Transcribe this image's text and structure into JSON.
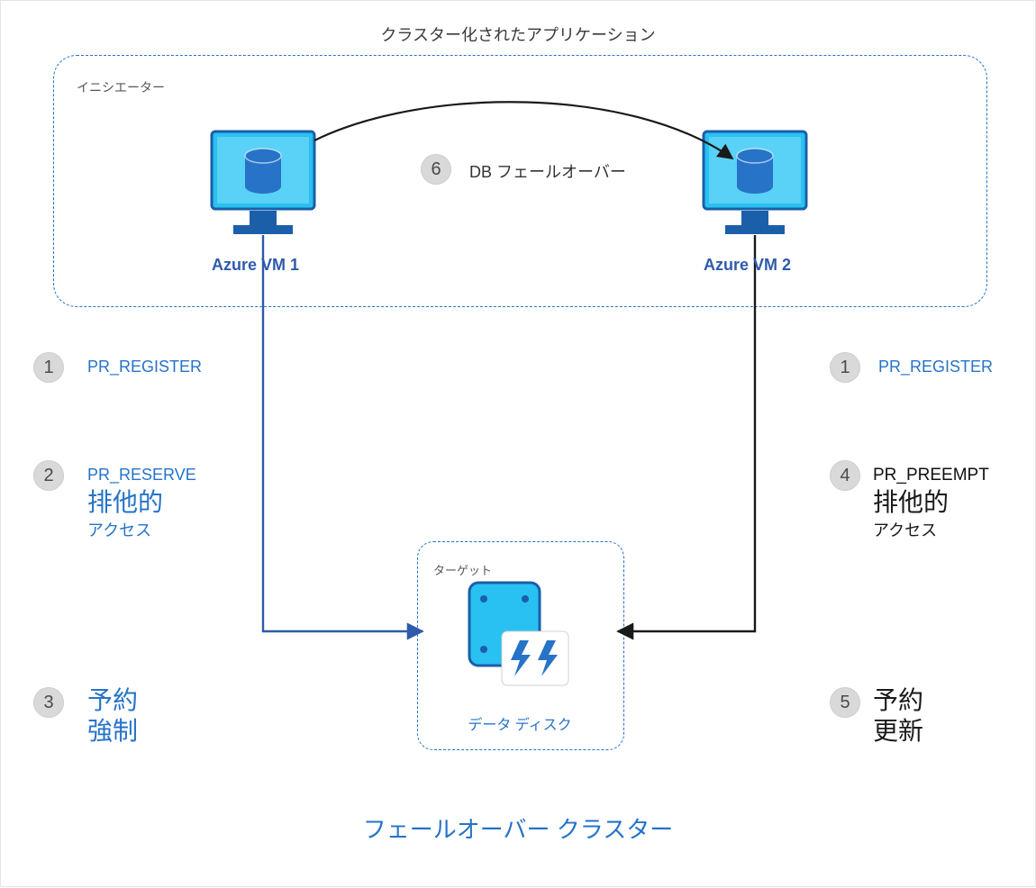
{
  "title": "クラスター化されたアプリケーション",
  "footer_title": "フェールオーバー クラスター",
  "initiator_label": "イニシエーター",
  "target_label": "ターゲット",
  "disk_label": "データ ディスク",
  "vm1_label": "Azure VM 1",
  "vm2_label": "Azure VM 2",
  "step6": {
    "num": "6",
    "label": "DB フェールオーバー"
  },
  "left": {
    "s1": {
      "num": "1",
      "code": "PR_REGISTER"
    },
    "s2": {
      "num": "2",
      "code": "PR_RESERVE",
      "big": "排他的",
      "sub": "アクセス"
    },
    "s3": {
      "num": "3",
      "big": "予約",
      "sub": "強制"
    }
  },
  "right": {
    "s1": {
      "num": "1",
      "code": "PR_REGISTER"
    },
    "s4": {
      "num": "4",
      "code": "PR_PREEMPT",
      "big": "排他的",
      "sub": "アクセス"
    },
    "s5": {
      "num": "5",
      "big": "予約",
      "sub": "更新"
    }
  },
  "colors": {
    "azure_blue": "#2673c8",
    "cyan_fill": "#29c0f2",
    "badge_bg": "#d9d9d9"
  }
}
